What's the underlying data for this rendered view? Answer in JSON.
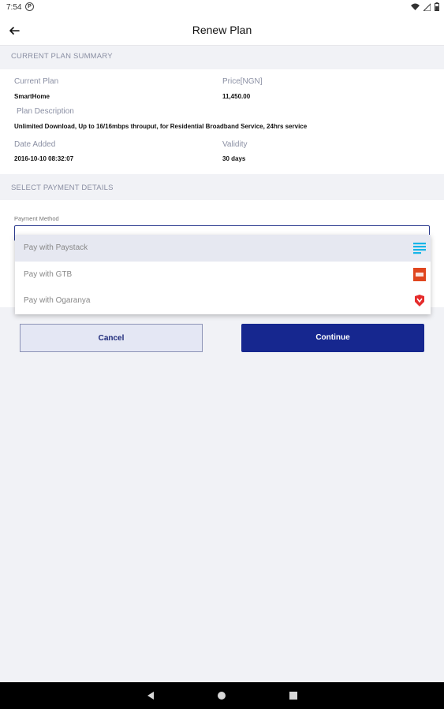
{
  "status_bar": {
    "time": "7:54",
    "notif_glyph": "P"
  },
  "app_bar": {
    "title": "Renew Plan",
    "back_icon": "arrow-left-icon"
  },
  "summary": {
    "header": "CURRENT PLAN SUMMARY",
    "current_plan_label": "Current Plan",
    "current_plan_value": "SmartHome",
    "price_label": "Price[NGN]",
    "price_value": "11,450.00",
    "description_label": "Plan Description",
    "description_value": "Unlimited Download, Up to 16/16mbps throuput, for Residential Broadband Service, 24hrs service",
    "date_label": "Date Added",
    "date_value": "2016-10-10 08:32:07",
    "validity_label": "Validity",
    "validity_value": "30 days"
  },
  "payment": {
    "header": "SELECT PAYMENT DETAILS",
    "method_label": "Payment Method",
    "options": [
      {
        "label": "Pay with Paystack",
        "icon": "paystack-icon",
        "color": "#17b5e8",
        "selected": true
      },
      {
        "label": "Pay with GTB",
        "icon": "gtb-icon",
        "color": "#e0461f",
        "selected": false
      },
      {
        "label": "Pay with Ogaranya",
        "icon": "ogaranya-icon",
        "color": "#e52b2b",
        "selected": false
      }
    ]
  },
  "buttons": {
    "cancel": "Cancel",
    "continue": "Continue"
  },
  "colors": {
    "primary": "#16278f",
    "cancel_bg": "#e4e7f4",
    "background": "#f1f2f6"
  }
}
